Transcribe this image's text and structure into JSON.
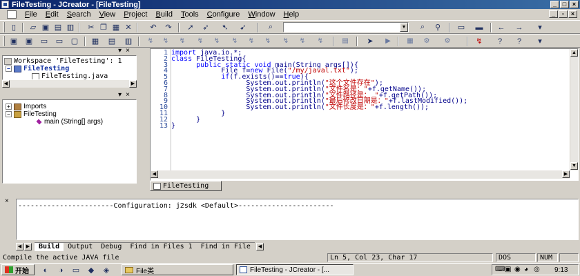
{
  "window": {
    "title": "FileTesting - JCreator - [FileTesting]"
  },
  "menu": [
    "File",
    "Edit",
    "Search",
    "View",
    "Project",
    "Build",
    "Tools",
    "Configure",
    "Window",
    "Help"
  ],
  "menu_mnemonics": [
    "F",
    "E",
    "S",
    "V",
    "P",
    "B",
    "T",
    "C",
    "W",
    "H"
  ],
  "toolbar": {
    "find_value": ""
  },
  "workspace": {
    "title": "Workspace 'FileTesting': 1",
    "project": "FileTesting",
    "file": "FileTesting.java"
  },
  "classview": {
    "imports": "Imports",
    "class": "FileTesting",
    "method": "main (String[] args)"
  },
  "editor": {
    "lines": [
      "import java.io.*;",
      "class FileTesting{",
      "      public static void main(String args[]){",
      "            File f=new File(\"/my/javal.txt\");",
      "            if(f.exists()==true){",
      "                  System.out.println(\"这个文件存在\");",
      "                  System.out.println(\"文件名是：\"+f.getName());",
      "                  System.out.println(\"文件路径是： \"+f.getPath());",
      "                  System.out.println(\"最后修改日期是：\"+f.lastModified());",
      "                  System.out.println(\"文件长度是：\"+f.length());",
      "            }",
      "      }",
      "}"
    ],
    "line_numbers": [
      "1",
      "2",
      "3",
      "4",
      "5",
      "6",
      "7",
      "8",
      "9",
      "10",
      "11",
      "12",
      "13"
    ],
    "tab": "FileTesting"
  },
  "output": {
    "text": "-----------------------Configuration: j2sdk <Default>-----------------------",
    "tabs": [
      "Build",
      "Output",
      "Debug",
      "Find in Files 1",
      "Find in File"
    ]
  },
  "status": {
    "message": "Compile the active JAVA file",
    "position": "Ln 5, Col 23, Char 17",
    "dos": "DOS",
    "num": "NUM"
  },
  "taskbar": {
    "start": "开始",
    "folder_task": "File类",
    "app_task": "FileTesting - JCreator - [...",
    "clock": "9:13"
  },
  "colors": {
    "titlebar_start": "#0a246a",
    "titlebar_end": "#3a6ea5",
    "keyword": "#0000ff",
    "string": "#c00000",
    "face": "#d4d0c8"
  }
}
